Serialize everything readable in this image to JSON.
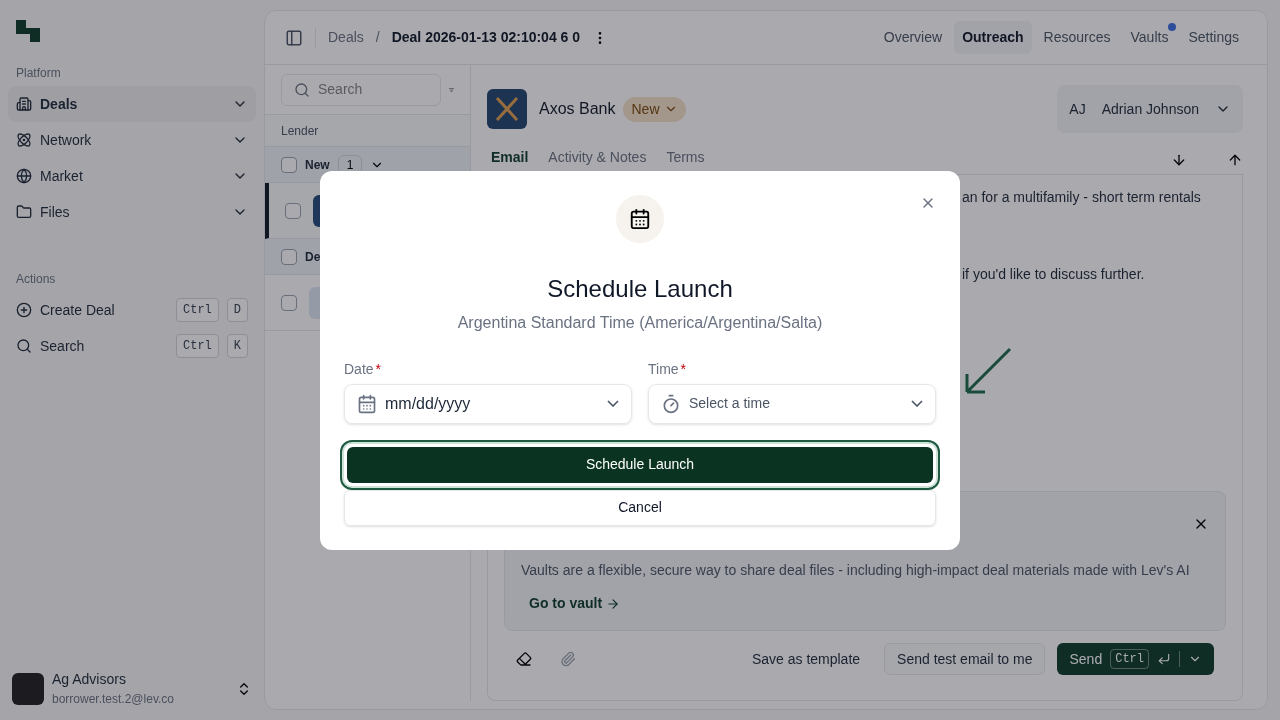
{
  "sidebar": {
    "sections": [
      {
        "title": "Platform",
        "items": [
          {
            "label": "Deals",
            "selected": true
          },
          {
            "label": "Network",
            "selected": false
          },
          {
            "label": "Market",
            "selected": false
          },
          {
            "label": "Files",
            "selected": false
          }
        ]
      },
      {
        "title": "Actions",
        "items": [
          {
            "label": "Create Deal",
            "keys": [
              "Ctrl",
              "D"
            ]
          },
          {
            "label": "Search",
            "keys": [
              "Ctrl",
              "K"
            ]
          }
        ]
      }
    ],
    "account": {
      "name": "Ag Advisors",
      "email": "borrower.test.2@lev.co"
    }
  },
  "header": {
    "breadcrumb": [
      "Deals",
      "/",
      "Deal 2026-01-13 02:10:04 6 0"
    ],
    "nav": [
      {
        "label": "Overview",
        "selected": false,
        "notification": false
      },
      {
        "label": "Outreach",
        "selected": true,
        "notification": false
      },
      {
        "label": "Resources",
        "selected": false,
        "notification": false
      },
      {
        "label": "Vaults",
        "selected": false,
        "notification": true
      },
      {
        "label": "Settings",
        "selected": false,
        "notification": false
      }
    ]
  },
  "list": {
    "search_placeholder": "Search",
    "column": "Lender",
    "rows": [
      {
        "kind": "group",
        "label": "New",
        "count": "1",
        "checked": false
      },
      {
        "kind": "lender",
        "selected": true,
        "checked": false
      },
      {
        "kind": "group",
        "label": "De",
        "checked": false
      },
      {
        "kind": "lender",
        "selected": false,
        "checked": false
      }
    ]
  },
  "detail": {
    "lender": "Axos Bank",
    "status": "New",
    "assignee_initials": "AJ",
    "assignee": "Adrian Johnson",
    "tabs": [
      {
        "label": "Email",
        "selected": true
      },
      {
        "label": "Activity & Notes",
        "selected": false
      },
      {
        "label": "Terms",
        "selected": false
      }
    ],
    "body": [
      "an for a multifamily - short term rentals",
      "if you'd like to discuss further."
    ],
    "vault_card": {
      "text": "Vaults are a flexible, secure way to share deal files - including high-impact deal materials made with Lev's AI",
      "link": "Go to vault"
    },
    "actions": {
      "template": "Save as template",
      "test": "Send test email to me",
      "send": "Send",
      "send_key": "Ctrl"
    }
  },
  "modal": {
    "title": "Schedule Launch",
    "subtitle": "Argentina Standard Time (America/Argentina/Salta)",
    "date": {
      "label": "Date",
      "required_mark": "*",
      "placeholder": "mm/dd/yyyy"
    },
    "time": {
      "label": "Time",
      "required_mark": "*",
      "placeholder": "Select a time"
    },
    "primary": {
      "label": "Schedule Launch",
      "focused": true
    },
    "secondary": "Cancel"
  }
}
